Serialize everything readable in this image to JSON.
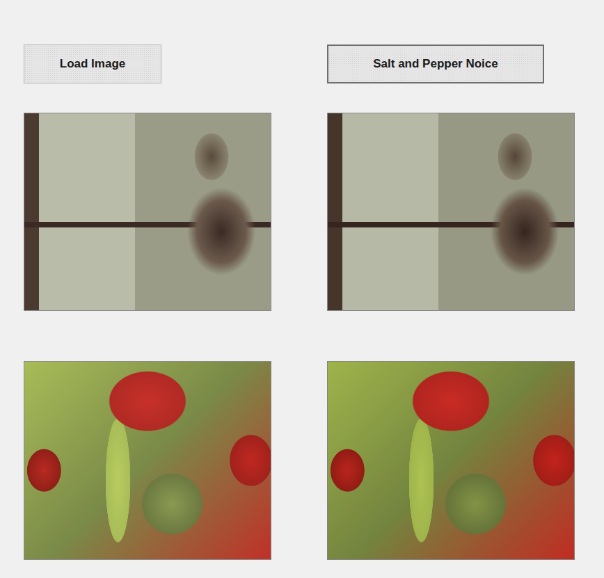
{
  "buttons": [
    {
      "label": "Load Image",
      "focused": false
    },
    {
      "label": "Salt and Pepper Noice",
      "focused": true
    }
  ]
}
